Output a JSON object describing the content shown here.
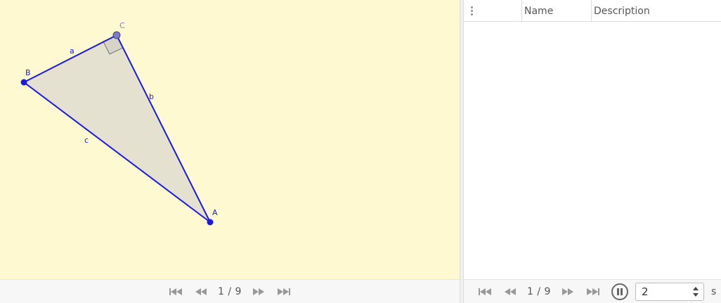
{
  "graphics": {
    "background": "#fef9d0",
    "points": {
      "A": {
        "label": "A"
      },
      "B": {
        "label": "B"
      },
      "C": {
        "label": "C"
      }
    },
    "segments": {
      "a": {
        "label": "a"
      },
      "b": {
        "label": "b"
      },
      "c": {
        "label": "c"
      }
    },
    "colors": {
      "line": "#1a1ae6",
      "fill": "#e5e1d0",
      "point": "#1a1ae6",
      "point_c": "#7b7bd6",
      "right_angle": "#d6d3c9"
    }
  },
  "nav_left": {
    "counter": "1 / 9",
    "buttons": [
      "first-icon",
      "previous-icon",
      "next-icon",
      "last-icon"
    ]
  },
  "protocol": {
    "columns": {
      "name": "Name",
      "description": "Description"
    },
    "rows": []
  },
  "nav_right": {
    "counter": "1 / 9",
    "speed_value": "2",
    "speed_unit": "s",
    "buttons": [
      "first-icon",
      "previous-icon",
      "next-icon",
      "last-icon",
      "pause-icon"
    ]
  }
}
